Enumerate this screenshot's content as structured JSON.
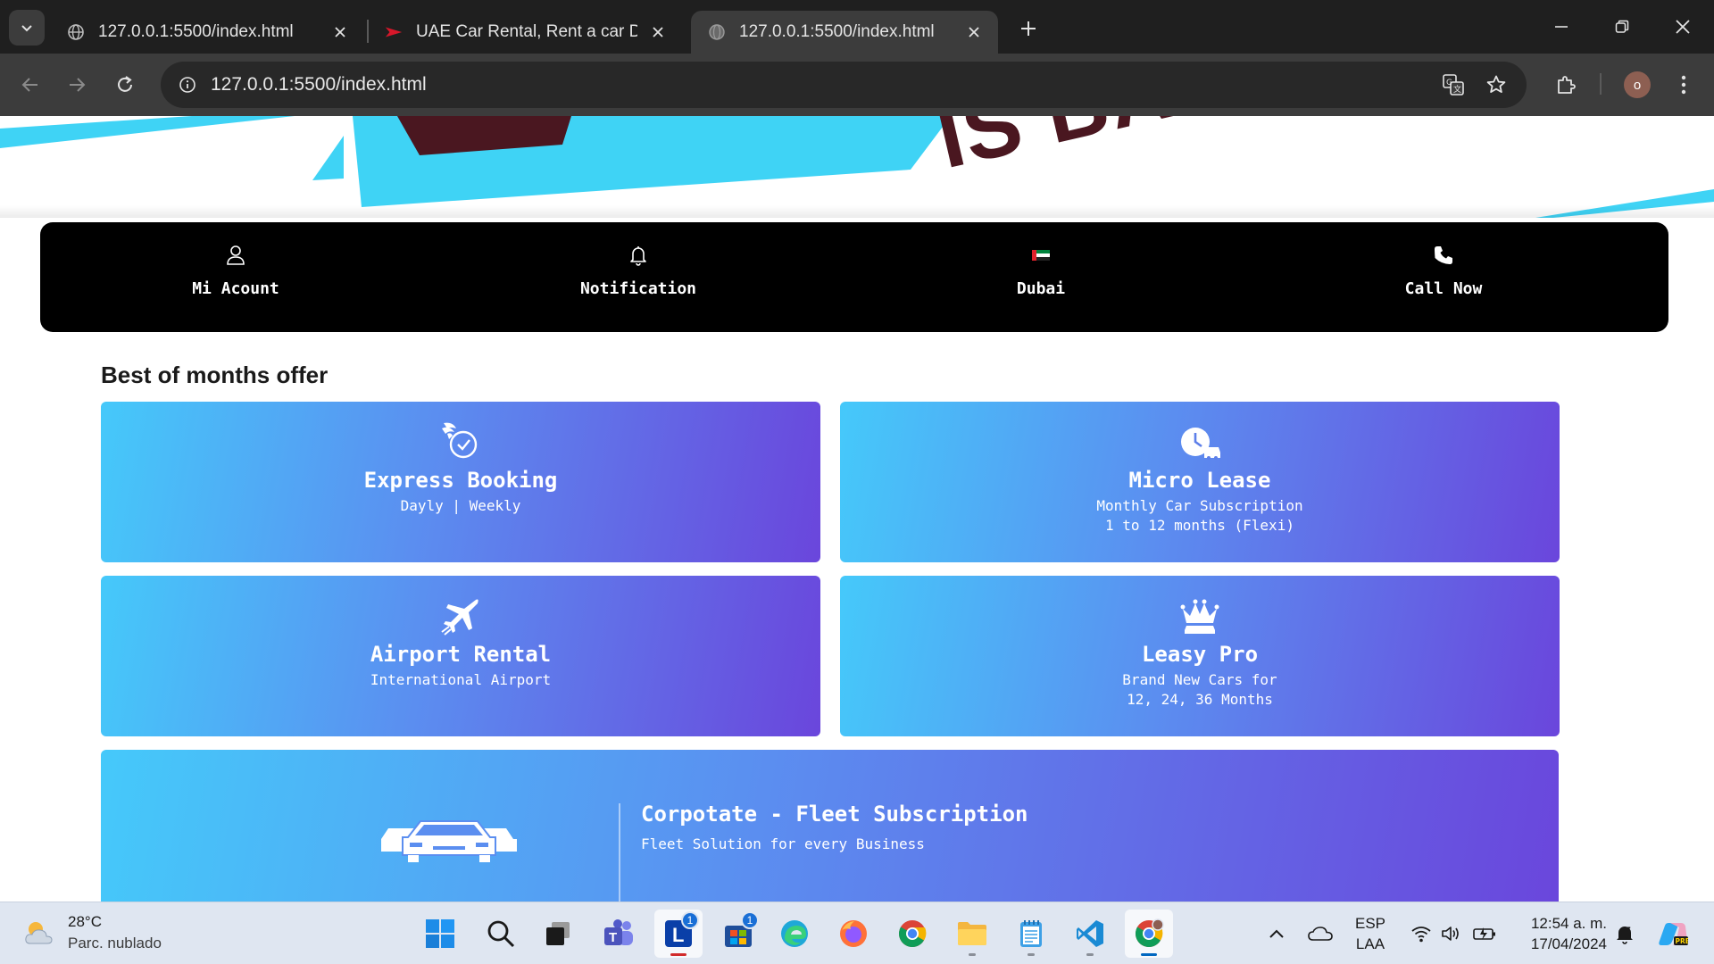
{
  "browser": {
    "tabs": [
      {
        "title": "127.0.0.1:5500/index.html",
        "active": false
      },
      {
        "title": "UAE Car Rental, Rent a car Dubai",
        "active": false
      },
      {
        "title": "127.0.0.1:5500/index.html",
        "active": true
      }
    ],
    "url": "127.0.0.1:5500/index.html",
    "profile_initial": "o"
  },
  "hero": {
    "text": "IS BACK"
  },
  "nav": {
    "items": [
      {
        "label": "Mi Acount",
        "icon": "user-icon"
      },
      {
        "label": "Notification",
        "icon": "bell-icon"
      },
      {
        "label": "Dubai",
        "icon": "uae-flag-icon"
      },
      {
        "label": "Call Now",
        "icon": "phone-icon"
      }
    ]
  },
  "offers": {
    "section_title": "Best of months offer",
    "cards": [
      {
        "title": "Express Booking",
        "subtitle_1": "Dayly | Weekly",
        "subtitle_2": "",
        "icon": "fast-clock-icon"
      },
      {
        "title": "Micro Lease",
        "subtitle_1": "Monthly Car Subscription",
        "subtitle_2": "1 to 12 months (Flexi)",
        "icon": "clock-car-icon"
      },
      {
        "title": "Airport Rental",
        "subtitle_1": "International Airport",
        "subtitle_2": "",
        "icon": "airplane-icon"
      },
      {
        "title": "Leasy Pro",
        "subtitle_1": "Brand New Cars for",
        "subtitle_2": "12, 24, 36 Months",
        "icon": "crown-car-icon"
      }
    ],
    "fleet": {
      "title": "Corpotate - Fleet Subscription",
      "subtitle": "Fleet Solution for every Business",
      "icon": "fleet-cars-icon"
    }
  },
  "taskbar": {
    "weather": {
      "temp": "28°C",
      "desc": "Parc. nublado"
    },
    "apps": [
      {
        "name": "start",
        "badge": ""
      },
      {
        "name": "search",
        "badge": ""
      },
      {
        "name": "task-view",
        "badge": ""
      },
      {
        "name": "teams",
        "badge": ""
      },
      {
        "name": "app-l",
        "badge": "1"
      },
      {
        "name": "store",
        "badge": "1"
      },
      {
        "name": "edge",
        "badge": ""
      },
      {
        "name": "firefox",
        "badge": ""
      },
      {
        "name": "chrome",
        "badge": ""
      },
      {
        "name": "file-explorer",
        "badge": ""
      },
      {
        "name": "notepad",
        "badge": ""
      },
      {
        "name": "vscode",
        "badge": ""
      },
      {
        "name": "chrome-profile",
        "badge": ""
      }
    ],
    "language": {
      "line1": "ESP",
      "line2": "LAA"
    },
    "clock": {
      "time": "12:54 a. m.",
      "date": "17/04/2024"
    }
  },
  "colors": {
    "card_gradient_start": "#45c9fa",
    "card_gradient_end": "#6a46dc",
    "navbar_bg": "#000000",
    "hero_cyan": "#3fd3f5"
  }
}
